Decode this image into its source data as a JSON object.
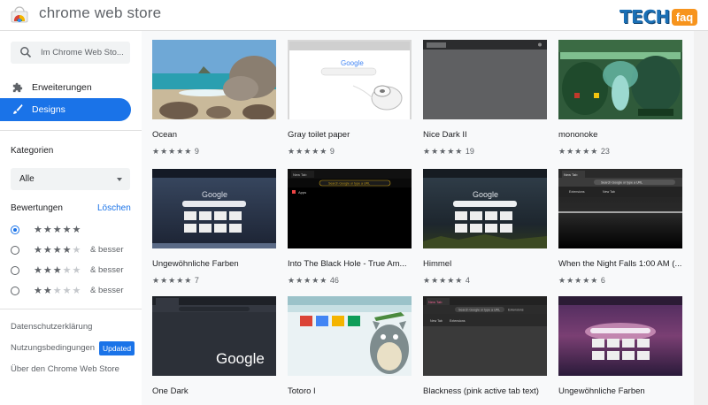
{
  "app": {
    "title": "chrome web store"
  },
  "watermark": {
    "tech": "TECH",
    "faq": "faq"
  },
  "sidebar": {
    "search_placeholder": "Im Chrome Web Sto...",
    "nav": [
      {
        "label": "Erweiterungen",
        "icon": "puzzle-icon",
        "active": false
      },
      {
        "label": "Designs",
        "icon": "brush-icon",
        "active": true
      }
    ],
    "categories_title": "Kategorien",
    "category_selected": "Alle",
    "ratings_title": "Bewertungen",
    "clear_label": "Löschen",
    "rating_filters": [
      {
        "stars": 5,
        "suffix": "",
        "selected": true
      },
      {
        "stars": 4,
        "suffix": "& besser",
        "selected": false
      },
      {
        "stars": 3,
        "suffix": "& besser",
        "selected": false
      },
      {
        "stars": 2,
        "suffix": "& besser",
        "selected": false
      }
    ],
    "footer": {
      "privacy": "Datenschutzerklärung",
      "terms": "Nutzungsbedingungen",
      "terms_badge": "Updated",
      "about": "Über den Chrome Web Store"
    }
  },
  "themes": [
    {
      "name": "Ocean",
      "rating": 5,
      "count": "9"
    },
    {
      "name": "Gray toilet paper",
      "rating": 5,
      "count": "9"
    },
    {
      "name": "Nice Dark II",
      "rating": 5,
      "count": "19"
    },
    {
      "name": "mononoke",
      "rating": 5,
      "count": "23"
    },
    {
      "name": "Ungewöhnliche Farben",
      "rating": 5,
      "count": "7"
    },
    {
      "name": "Into The Black Hole - True Am...",
      "rating": 5,
      "count": "46"
    },
    {
      "name": "Himmel",
      "rating": 5,
      "count": "4"
    },
    {
      "name": "When the Night Falls 1:00 AM (...",
      "rating": 5,
      "count": "6"
    },
    {
      "name": "One Dark",
      "rating": null,
      "count": ""
    },
    {
      "name": "Totoro I",
      "rating": null,
      "count": ""
    },
    {
      "name": "Blackness (pink active tab text)",
      "rating": null,
      "count": ""
    },
    {
      "name": "Ungewöhnliche Farben",
      "rating": null,
      "count": ""
    }
  ],
  "thumb_text": {
    "google": "Google",
    "new_tab": "New Tab",
    "search_hint": "Search Google or type a URL",
    "apps": "Apps",
    "extensions": "Extensions"
  },
  "colors": {
    "accent": "#1a73e8",
    "text": "#202124",
    "muted": "#5f6368"
  }
}
